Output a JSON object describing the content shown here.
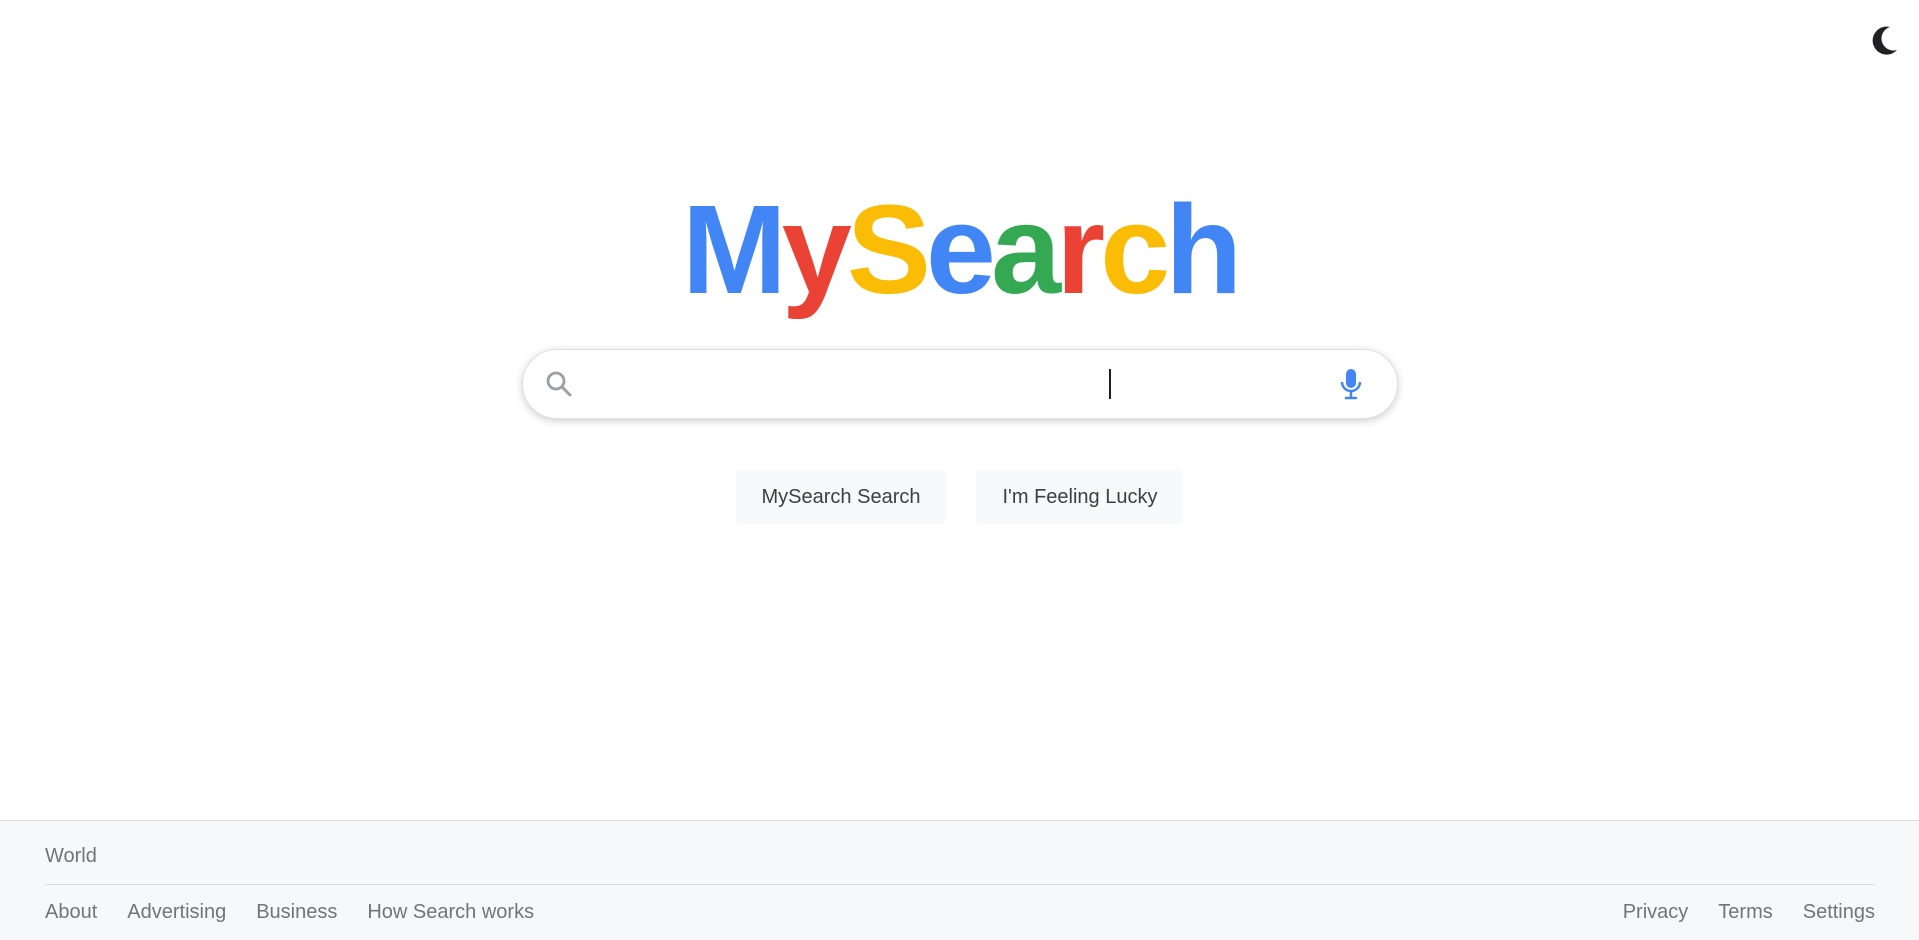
{
  "header": {
    "theme_toggle_icon": "moon-icon"
  },
  "logo": {
    "letters": [
      {
        "char": "M",
        "color": "#4285f4"
      },
      {
        "char": "y",
        "color": "#ea4335"
      },
      {
        "char": "S",
        "color": "#fbbc05"
      },
      {
        "char": "e",
        "color": "#4285f4"
      },
      {
        "char": "a",
        "color": "#34a853"
      },
      {
        "char": "r",
        "color": "#ea4335"
      },
      {
        "char": "c",
        "color": "#fbbc05"
      },
      {
        "char": "h",
        "color": "#4285f4"
      }
    ]
  },
  "search": {
    "value": "",
    "placeholder": "",
    "search_icon": "search-icon",
    "mic_icon": "microphone-icon"
  },
  "buttons": {
    "search_label": "MySearch Search",
    "lucky_label": "I'm Feeling Lucky"
  },
  "footer": {
    "country": "World",
    "left_links": [
      "About",
      "Advertising",
      "Business",
      "How Search works"
    ],
    "right_links": [
      "Privacy",
      "Terms",
      "Settings"
    ]
  },
  "colors": {
    "blue": "#4285f4",
    "red": "#ea4335",
    "yellow": "#fbbc05",
    "green": "#34a853"
  }
}
